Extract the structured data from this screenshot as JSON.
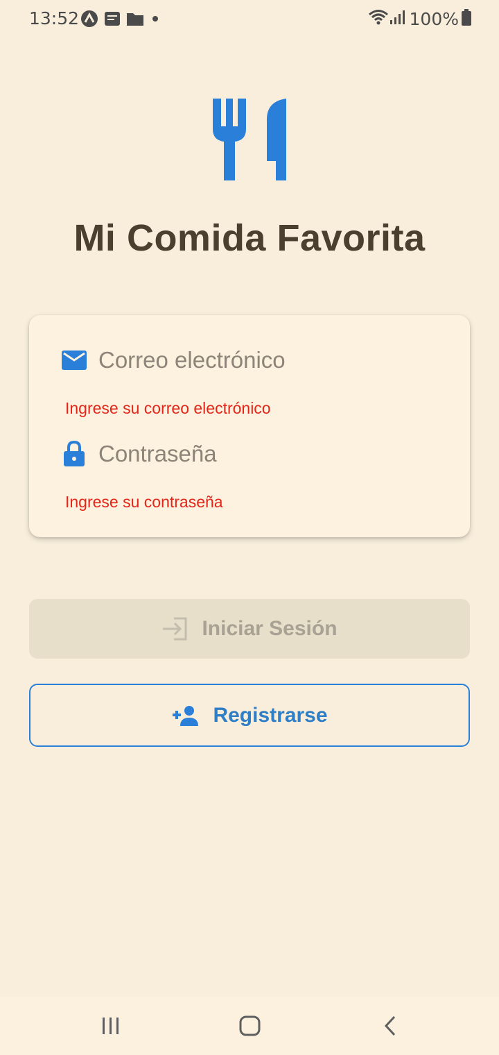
{
  "status_bar": {
    "time": "13:52",
    "battery_percent": "100%",
    "icons": [
      "app-a-icon",
      "notification-app-icon",
      "folder-icon",
      "dot-icon",
      "wifi-icon",
      "signal-icon",
      "battery-icon"
    ]
  },
  "app": {
    "title": "Mi Comida Favorita",
    "logo_icon": "fork-knife-icon",
    "accent_color": "#2a7fd8"
  },
  "login_form": {
    "email": {
      "placeholder": "Correo electrónico",
      "value": "",
      "icon": "mail-icon",
      "error": "Ingrese su correo electrónico"
    },
    "password": {
      "placeholder": "Contraseña",
      "value": "",
      "icon": "lock-icon",
      "error": "Ingrese su contraseña"
    },
    "error_color": "#e3261a"
  },
  "actions": {
    "login_label": "Iniciar Sesión",
    "login_icon": "login-icon",
    "login_enabled": false,
    "register_label": "Registrarse",
    "register_icon": "person-add-icon"
  },
  "nav_bar": {
    "buttons": [
      "recent-apps-icon",
      "home-icon",
      "back-icon"
    ]
  }
}
